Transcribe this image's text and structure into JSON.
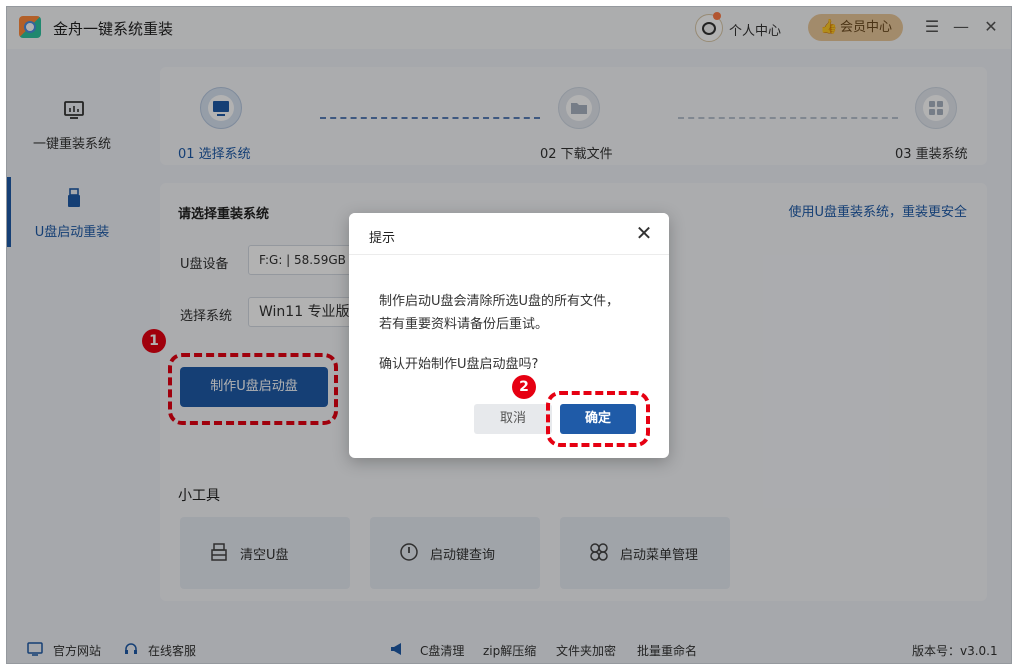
{
  "app": {
    "title": "金舟一键系统重装",
    "personal_center": "个人中心",
    "vip_center": "会员中心"
  },
  "sidebar": {
    "items": [
      {
        "label": "一键重装系统",
        "icon": "monitor-chart-icon",
        "active": false
      },
      {
        "label": "U盘启动重装",
        "icon": "usb-drive-icon",
        "active": true
      }
    ]
  },
  "steps": [
    {
      "label": "01 选择系统",
      "icon": "monitor-icon",
      "active": true
    },
    {
      "label": "02 下载文件",
      "icon": "folder-icon",
      "active": false
    },
    {
      "label": "03 重装系统",
      "icon": "windows-icon",
      "active": false
    }
  ],
  "main": {
    "section_title": "请选择重装系统",
    "safe_link": "使用U盘重装系统，重装更安全",
    "usb_label": "U盘设备",
    "usb_value": "F:G: | 58.59GB |",
    "system_label": "选择系统",
    "system_value": "Win11 专业版",
    "make_button": "制作U盘启动盘",
    "badge_1": "1",
    "tools_title": "小工具",
    "tools": [
      {
        "label": "清空U盘",
        "icon": "usb-clear-icon"
      },
      {
        "label": "启动键查询",
        "icon": "power-icon"
      },
      {
        "label": "启动菜单管理",
        "icon": "menu-grid-icon"
      }
    ]
  },
  "footer": {
    "official_site": "官方网站",
    "online_service": "在线客服",
    "c_clean": "C盘清理",
    "zip": "zip解压缩",
    "folder_encrypt": "文件夹加密",
    "batch_rename": "批量重命名",
    "version": "版本号：v3.0.1"
  },
  "dialog": {
    "title": "提示",
    "line1": "制作启动U盘会清除所选U盘的所有文件，",
    "line2": "若有重要资料请备份后重试。",
    "line3": "确认开始制作U盘启动盘吗?",
    "cancel": "取消",
    "ok": "确定",
    "badge_2": "2"
  },
  "colors": {
    "accent": "#1f5ba8",
    "highlight": "#e60012",
    "vip": "#e9c79a"
  }
}
